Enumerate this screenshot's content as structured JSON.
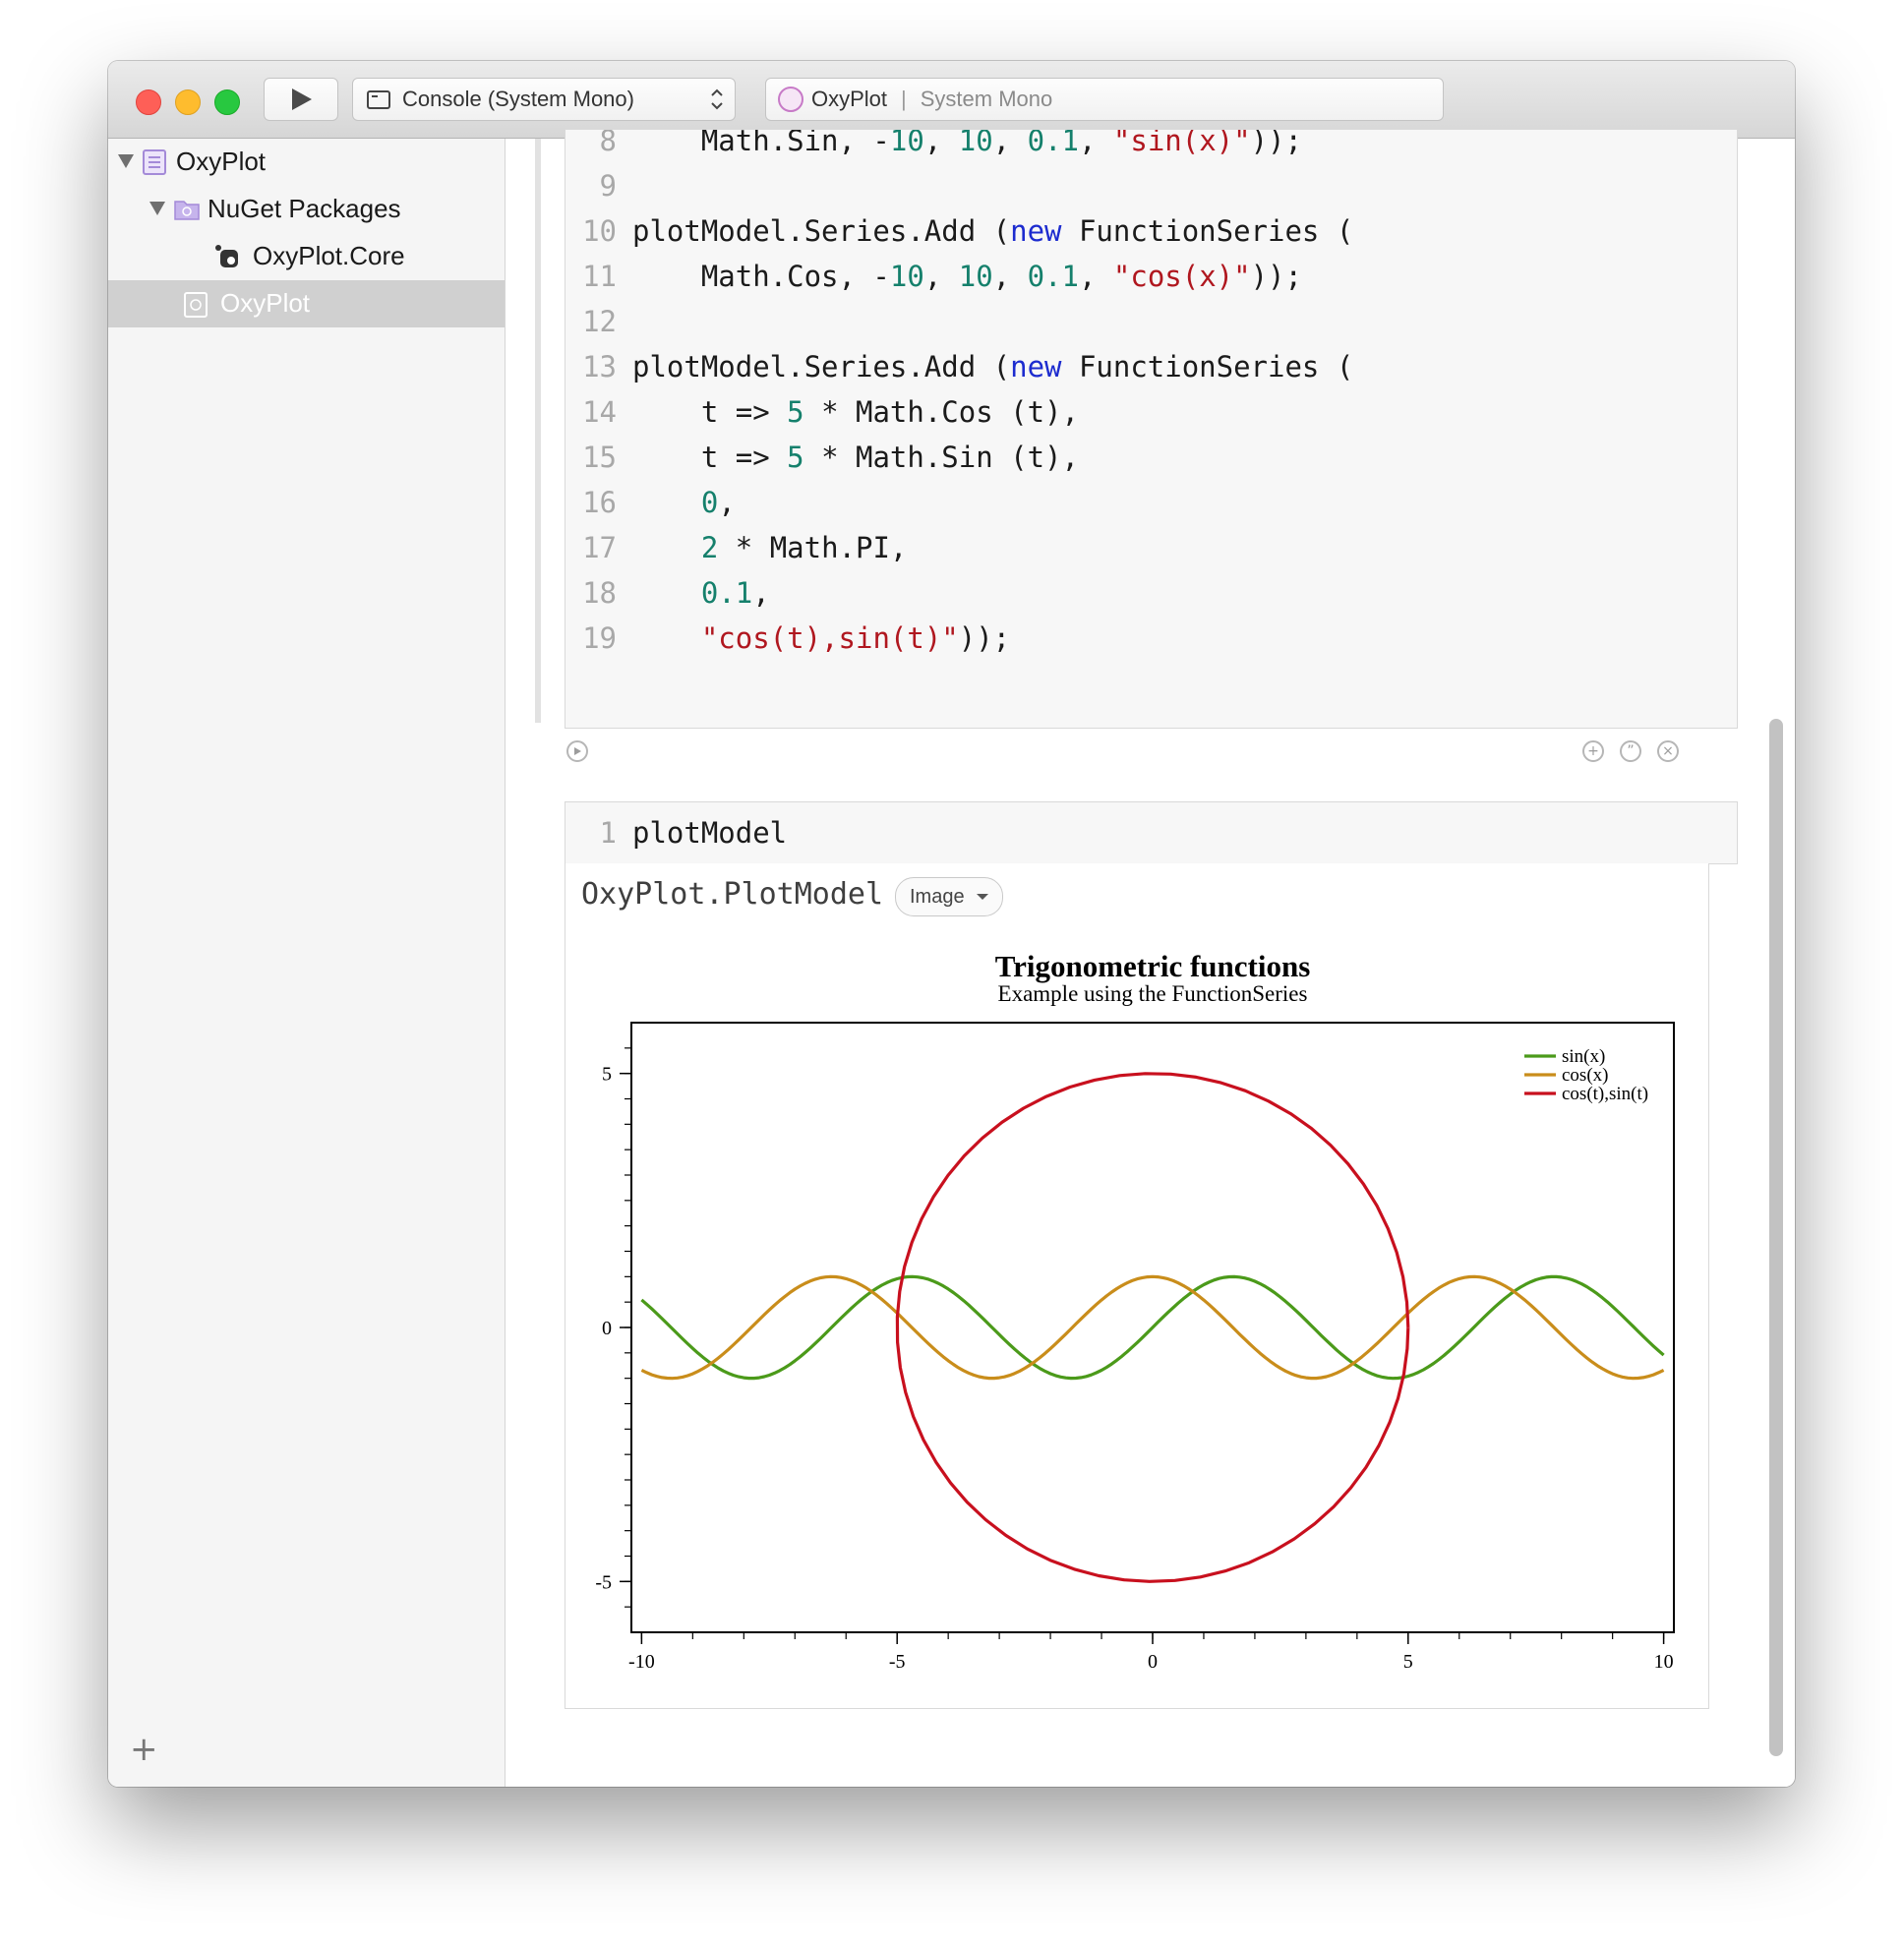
{
  "toolbar": {
    "scheme_label": "Console (System Mono)",
    "app_name": "OxyPlot",
    "font_label": "System Mono"
  },
  "sidebar": {
    "items": [
      {
        "label": "OxyPlot"
      },
      {
        "label": "NuGet Packages"
      },
      {
        "label": "OxyPlot.Core"
      },
      {
        "label": "OxyPlot"
      }
    ],
    "add_label": "+"
  },
  "editor": {
    "lines": [
      {
        "n": "8",
        "tokens": [
          {
            "t": "    Math.Sin, -",
            "c": ""
          },
          {
            "t": "10",
            "c": "num"
          },
          {
            "t": ", ",
            "c": ""
          },
          {
            "t": "10",
            "c": "num"
          },
          {
            "t": ", ",
            "c": ""
          },
          {
            "t": "0.1",
            "c": "num"
          },
          {
            "t": ", ",
            "c": ""
          },
          {
            "t": "\"sin(x)\"",
            "c": "str"
          },
          {
            "t": "));",
            "c": ""
          }
        ]
      },
      {
        "n": "9",
        "tokens": []
      },
      {
        "n": "10",
        "tokens": [
          {
            "t": "plotModel.Series.Add (",
            "c": ""
          },
          {
            "t": "new",
            "c": "kw"
          },
          {
            "t": " FunctionSeries (",
            "c": ""
          }
        ]
      },
      {
        "n": "11",
        "tokens": [
          {
            "t": "    Math.Cos, -",
            "c": ""
          },
          {
            "t": "10",
            "c": "num"
          },
          {
            "t": ", ",
            "c": ""
          },
          {
            "t": "10",
            "c": "num"
          },
          {
            "t": ", ",
            "c": ""
          },
          {
            "t": "0.1",
            "c": "num"
          },
          {
            "t": ", ",
            "c": ""
          },
          {
            "t": "\"cos(x)\"",
            "c": "str"
          },
          {
            "t": "));",
            "c": ""
          }
        ]
      },
      {
        "n": "12",
        "tokens": []
      },
      {
        "n": "13",
        "tokens": [
          {
            "t": "plotModel.Series.Add (",
            "c": ""
          },
          {
            "t": "new",
            "c": "kw"
          },
          {
            "t": " FunctionSeries (",
            "c": ""
          }
        ]
      },
      {
        "n": "14",
        "tokens": [
          {
            "t": "    t => ",
            "c": ""
          },
          {
            "t": "5",
            "c": "num"
          },
          {
            "t": " * Math.Cos (t),",
            "c": ""
          }
        ]
      },
      {
        "n": "15",
        "tokens": [
          {
            "t": "    t => ",
            "c": ""
          },
          {
            "t": "5",
            "c": "num"
          },
          {
            "t": " * Math.Sin (t),",
            "c": ""
          }
        ]
      },
      {
        "n": "16",
        "tokens": [
          {
            "t": "    ",
            "c": ""
          },
          {
            "t": "0",
            "c": "num"
          },
          {
            "t": ",",
            "c": ""
          }
        ]
      },
      {
        "n": "17",
        "tokens": [
          {
            "t": "    ",
            "c": ""
          },
          {
            "t": "2",
            "c": "num"
          },
          {
            "t": " * Math.PI,",
            "c": ""
          }
        ]
      },
      {
        "n": "18",
        "tokens": [
          {
            "t": "    ",
            "c": ""
          },
          {
            "t": "0.1",
            "c": "num"
          },
          {
            "t": ",",
            "c": ""
          }
        ]
      },
      {
        "n": "19",
        "tokens": [
          {
            "t": "    ",
            "c": ""
          },
          {
            "t": "\"cos(t),sin(t)\"",
            "c": "str"
          },
          {
            "t": "));",
            "c": ""
          }
        ]
      }
    ]
  },
  "input_cell": {
    "line_number": "1",
    "code": "plotModel"
  },
  "result": {
    "type_label": "OxyPlot.PlotModel",
    "render_mode": "Image"
  },
  "colors": {
    "keyword": "#1d2ccf",
    "number": "#15806c",
    "string": "#b0171f",
    "sin": "#4b9a1a",
    "cos": "#c98d1b",
    "circle": "#c8101e"
  },
  "chart_data": {
    "type": "line",
    "title": "Trigonometric functions",
    "subtitle": "Example using the FunctionSeries",
    "xlabel": "",
    "ylabel": "",
    "xlim": [
      -10.2,
      10.2
    ],
    "ylim": [
      -6,
      6
    ],
    "xticks": [
      -10,
      -5,
      0,
      5,
      10
    ],
    "yticks": [
      -5,
      0,
      5
    ],
    "grid": false,
    "legend_position": "top-right",
    "series": [
      {
        "name": "sin(x)",
        "function": "sin(x)",
        "x_range": [
          -10,
          10
        ],
        "step": 0.1,
        "color": "#4b9a1a"
      },
      {
        "name": "cos(x)",
        "function": "cos(x)",
        "x_range": [
          -10,
          10
        ],
        "step": 0.1,
        "color": "#c98d1b"
      },
      {
        "name": "cos(t),sin(t)",
        "function": "(5*cos(t), 5*sin(t))",
        "t_range": [
          0,
          6.2832
        ],
        "step": 0.1,
        "color": "#c8101e"
      }
    ]
  }
}
